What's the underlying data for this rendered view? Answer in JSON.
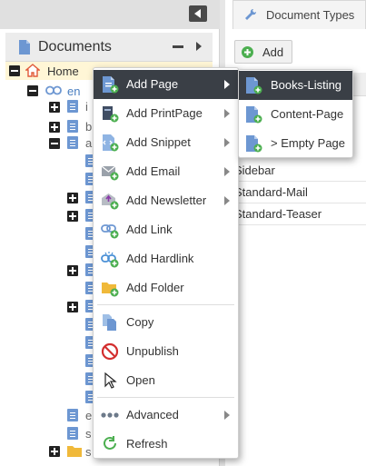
{
  "tree": {
    "header_title": "Documents",
    "home_label": "Home",
    "en_label": "en",
    "truncated": [
      "i",
      "b",
      "a",
      "e",
      "s",
      "s"
    ]
  },
  "right": {
    "tab_label": "Document Types",
    "add_label": "Add",
    "rows": [
      "Sidebar",
      "Standard-Mail",
      "Standard-Teaser"
    ]
  },
  "context_menu": {
    "items": [
      {
        "label": "Add Page",
        "icon": "add-page-icon"
      },
      {
        "label": "Add PrintPage",
        "icon": "add-printpage-icon"
      },
      {
        "label": "Add Snippet",
        "icon": "add-snippet-icon"
      },
      {
        "label": "Add Email",
        "icon": "add-email-icon"
      },
      {
        "label": "Add Newsletter",
        "icon": "add-newsletter-icon"
      },
      {
        "label": "Add Link",
        "icon": "add-link-icon"
      },
      {
        "label": "Add Hardlink",
        "icon": "add-hardlink-icon"
      },
      {
        "label": "Add Folder",
        "icon": "add-folder-icon"
      },
      {
        "label": "Copy",
        "icon": "copy-icon"
      },
      {
        "label": "Unpublish",
        "icon": "unpublish-icon"
      },
      {
        "label": "Open",
        "icon": "open-cursor-icon"
      },
      {
        "label": "Advanced",
        "icon": "more-dots-icon"
      },
      {
        "label": "Refresh",
        "icon": "refresh-icon"
      }
    ]
  },
  "submenu": {
    "items": [
      {
        "label": "Books-Listing",
        "icon": "add-page-icon"
      },
      {
        "label": "Content-Page",
        "icon": "add-page-icon"
      },
      {
        "label": "> Empty Page",
        "icon": "add-page-icon"
      }
    ]
  },
  "colors": {
    "menu_active": "#3a3f46",
    "icon_blue": "#6d97d2",
    "plus_green": "#4caf50",
    "home_highlight": "#fff6d6"
  }
}
